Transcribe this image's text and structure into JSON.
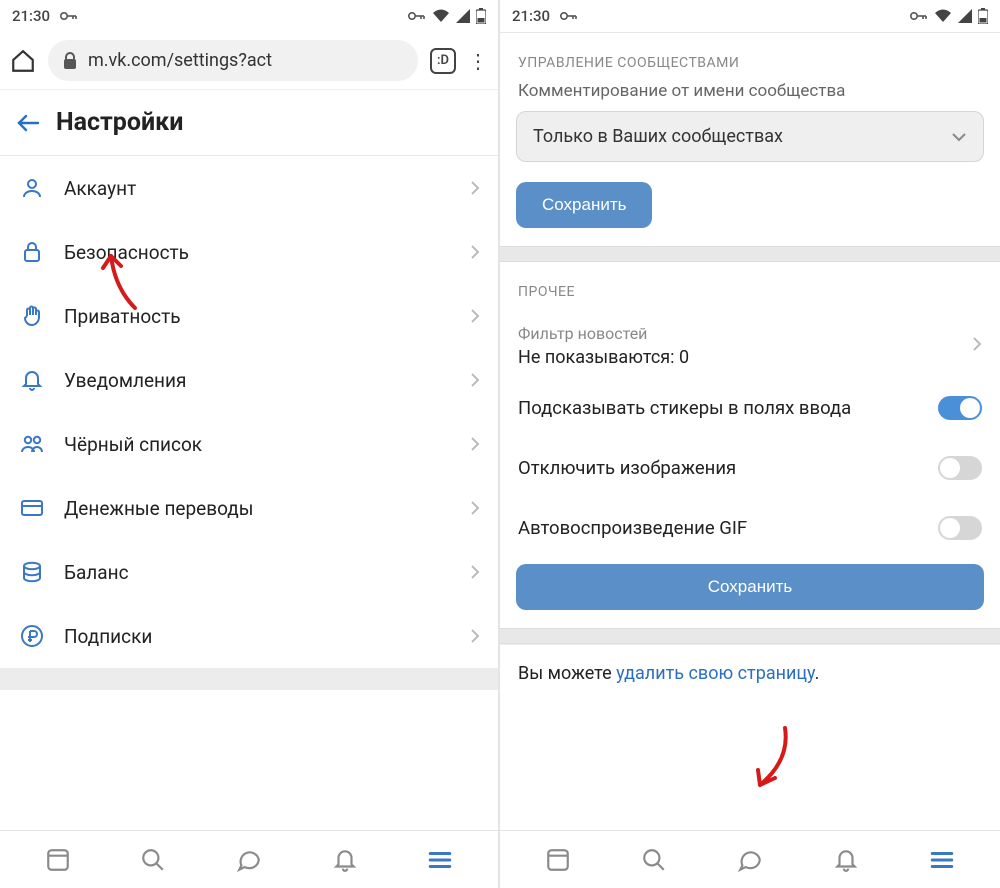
{
  "statusbar": {
    "time": "21:30"
  },
  "left": {
    "url": "m.vk.com/settings?act",
    "tab_count": ":D",
    "title": "Настройки",
    "items": [
      {
        "label": "Аккаунт"
      },
      {
        "label": "Безопасность"
      },
      {
        "label": "Приватность"
      },
      {
        "label": "Уведомления"
      },
      {
        "label": "Чёрный список"
      },
      {
        "label": "Денежные переводы"
      },
      {
        "label": "Баланс"
      },
      {
        "label": "Подписки"
      }
    ]
  },
  "right": {
    "section1_header": "УПРАВЛЕНИЕ СООБЩЕСТВАМИ",
    "comment_label": "Комментирование от имени сообщества",
    "comment_value": "Только в Ваших сообществах",
    "save_label": "Сохранить",
    "section2_header": "ПРОЧЕЕ",
    "news_filter_label": "Фильтр новостей",
    "news_filter_value": "Не показываются: 0",
    "toggle_stickers": "Подсказывать стикеры в полях ввода",
    "toggle_images": "Отключить изображения",
    "toggle_gif": "Автовоспроизведение GIF",
    "delete_prefix": "Вы можете ",
    "delete_link": "удалить свою страницу",
    "delete_suffix": "."
  }
}
